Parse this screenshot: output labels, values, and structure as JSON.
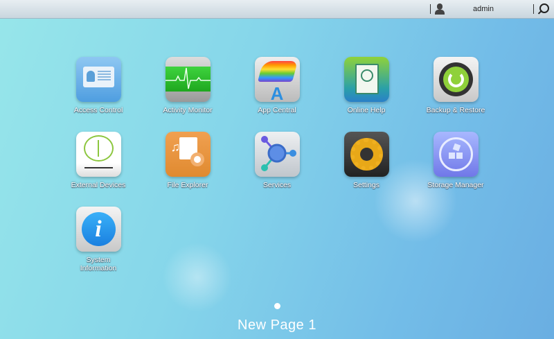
{
  "topbar": {
    "username": "admin",
    "user_icon": "user-icon",
    "search_icon": "search-icon"
  },
  "apps": [
    {
      "label": "Access Control",
      "icon": "id-card-icon"
    },
    {
      "label": "Activity Monitor",
      "icon": "heartbeat-monitor-icon"
    },
    {
      "label": "App Central",
      "icon": "app-central-icon"
    },
    {
      "label": "Online Help",
      "icon": "help-book-icon"
    },
    {
      "label": "Backup & Restore",
      "icon": "backup-restore-icon"
    },
    {
      "label": "External Devices",
      "icon": "usb-icon"
    },
    {
      "label": "File Explorer",
      "icon": "file-explorer-icon"
    },
    {
      "label": "Services",
      "icon": "services-network-icon"
    },
    {
      "label": "Settings",
      "icon": "gear-icon"
    },
    {
      "label": "Storage Manager",
      "icon": "storage-manager-icon"
    },
    {
      "label": "System Information",
      "icon": "info-icon"
    }
  ],
  "pager": {
    "label": "New Page 1"
  }
}
